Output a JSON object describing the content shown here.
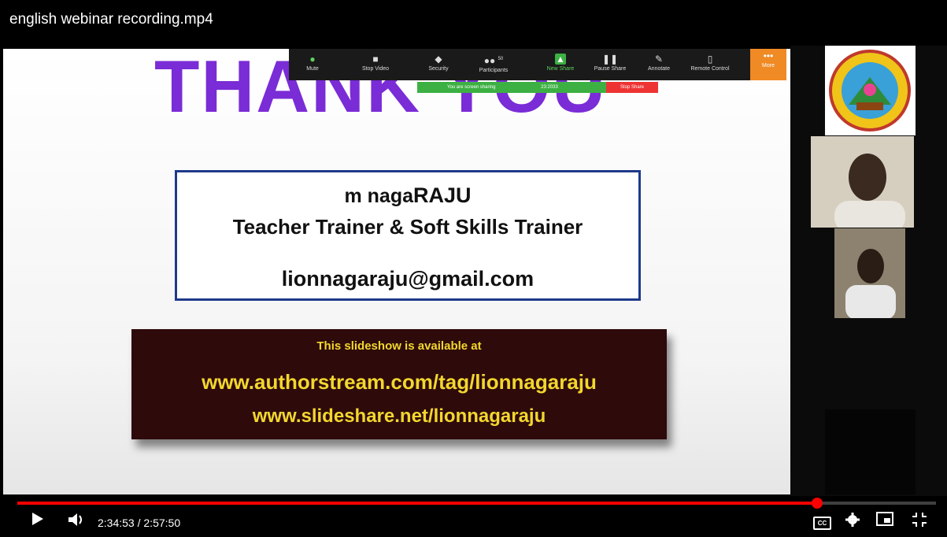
{
  "window": {
    "title": "english webinar recording.mp4"
  },
  "slide": {
    "heading": "THANK YOU",
    "card": {
      "name_prefix": "m naga",
      "name_suffix": "RAJU",
      "role": "Teacher Trainer & Soft Skills Trainer",
      "email": "lionnagaraju@gmail.com"
    },
    "promo": {
      "line1": "This slideshow is available at",
      "link1": "www.authorstream.com/tag/lionnagaraju",
      "link2": "www.slideshare.net/lionnagaraju"
    }
  },
  "zoom_toolbar": {
    "items": [
      {
        "label": "Mute",
        "icon": "mic-icon"
      },
      {
        "label": "Stop Video",
        "icon": "video-icon"
      },
      {
        "label": "Security",
        "icon": "shield-icon"
      },
      {
        "label": "Participants",
        "icon": "participants-icon",
        "badge": "50"
      },
      {
        "label": "New Share",
        "icon": "share-icon"
      },
      {
        "label": "Pause Share",
        "icon": "pause-icon"
      },
      {
        "label": "Annotate",
        "icon": "pen-icon"
      },
      {
        "label": "Remote Control",
        "icon": "mouse-icon"
      }
    ],
    "more": "More",
    "sharing_status": "You are screen sharing",
    "share_id": "23:2033",
    "stop_share": "Stop Share"
  },
  "player": {
    "time_current": "2:34:53",
    "time_total": "2:57:50",
    "progress": 0.871,
    "colors": {
      "accent": "#ff0000"
    }
  }
}
